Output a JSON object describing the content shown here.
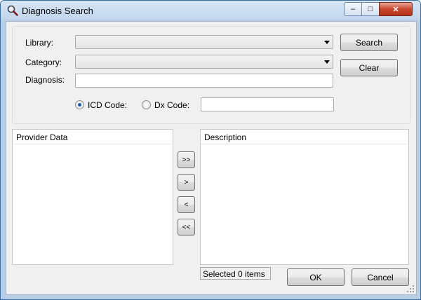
{
  "window": {
    "title": "Diagnosis Search",
    "minimize_glyph": "–",
    "maximize_glyph": "□",
    "close_glyph": "✕"
  },
  "form": {
    "library_label": "Library:",
    "category_label": "Category:",
    "diagnosis_label": "Diagnosis:",
    "library_value": "",
    "category_value": "",
    "diagnosis_value": "",
    "search_label": "Search",
    "clear_label": "Clear",
    "icd_label": "ICD Code:",
    "dx_label": "Dx Code:",
    "code_value": "",
    "selected_code_type": "ICD"
  },
  "provider_panel": {
    "header": "Provider Data",
    "items": []
  },
  "description_panel": {
    "header": "Description",
    "items": []
  },
  "transfer": {
    "add_all_label": ">>",
    "add_label": ">",
    "remove_label": "<",
    "remove_all_label": "<<"
  },
  "footer": {
    "status_text": "Selected 0 items",
    "ok_label": "OK",
    "cancel_label": "Cancel"
  }
}
